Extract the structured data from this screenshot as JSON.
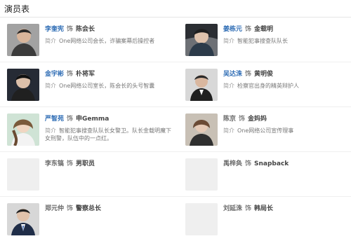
{
  "header": {
    "title": "演员表"
  },
  "rows": [
    [
      {
        "actor": "李奎宪",
        "as": "饰",
        "role": "陈会长",
        "desc_label": "简介",
        "desc": "One网络公司会长，诈骗案幕后操控者",
        "photo": true,
        "actor_link": true
      },
      {
        "actor": "姜栋元",
        "as": "饰",
        "role": "金载明",
        "desc_label": "简介",
        "desc": "智能犯事搜查队队长",
        "photo": true,
        "actor_link": true
      }
    ],
    [
      {
        "actor": "金宇彬",
        "as": "饰",
        "role": "朴将军",
        "desc_label": "简介",
        "desc": "One网络公司室长，陈会长的头号智囊",
        "photo": true,
        "actor_link": true
      },
      {
        "actor": "吴达洙",
        "as": "饰",
        "role": "黄明俊",
        "desc_label": "简介",
        "desc": "检察官出身的精英辩护人",
        "photo": true,
        "actor_link": true
      }
    ],
    [
      {
        "actor": "严智苑",
        "as": "饰",
        "role": "申Gemma",
        "desc_label": "简介",
        "desc": "智能犯事搜查队队长女警卫。队长金载明魔下女刑警，队伍中的一点红。",
        "photo": true,
        "actor_link": true
      },
      {
        "actor": "陈京",
        "as": "饰",
        "role": "金妈妈",
        "desc_label": "简介",
        "desc": "One网络公司宣传理事",
        "photo": true,
        "actor_link": false
      }
    ],
    [
      {
        "actor": "李东镐",
        "as": "饰",
        "role": "男职员",
        "desc_label": "",
        "desc": "",
        "photo": false,
        "actor_link": false
      },
      {
        "actor": "禹梓奂",
        "as": "饰",
        "role": "Snapback",
        "desc_label": "",
        "desc": "",
        "photo": false,
        "actor_link": false
      }
    ],
    [
      {
        "actor": "郑元仲",
        "as": "饰",
        "role": "警察总长",
        "desc_label": "",
        "desc": "",
        "photo": true,
        "actor_link": false
      },
      {
        "actor": "刘延洙",
        "as": "饰",
        "role": "韩局长",
        "desc_label": "",
        "desc": "",
        "photo": false,
        "actor_link": false
      }
    ]
  ]
}
